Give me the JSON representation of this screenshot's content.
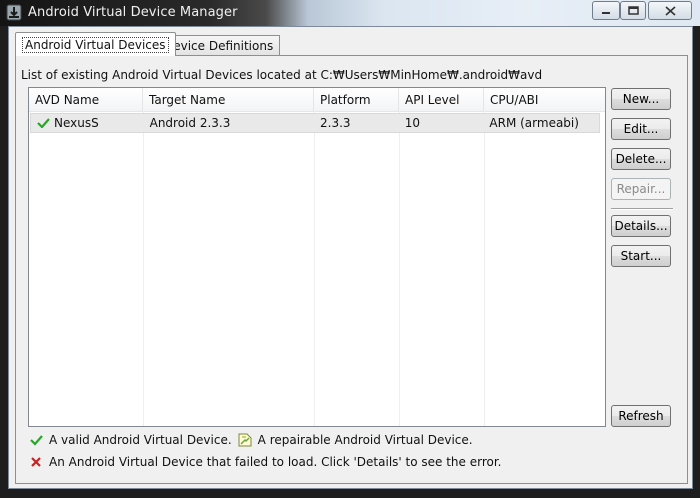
{
  "window": {
    "title": "Android Virtual Device Manager"
  },
  "tabs": [
    {
      "label": "Android Virtual Devices"
    },
    {
      "label": "Device Definitions"
    }
  ],
  "list_label": "List of existing Android Virtual Devices located at C:₩Users₩MinHome₩.android₩avd",
  "table": {
    "columns": [
      "AVD Name",
      "Target Name",
      "Platform",
      "API Level",
      "CPU/ABI"
    ],
    "rows": [
      {
        "status": "valid",
        "name": "NexusS",
        "target": "Android 2.3.3",
        "platform": "2.3.3",
        "api": "10",
        "cpu": "ARM (armeabi)"
      }
    ]
  },
  "buttons": {
    "new": "New...",
    "edit": "Edit...",
    "delete": "Delete...",
    "repair": "Repair...",
    "details": "Details...",
    "start": "Start...",
    "refresh": "Refresh"
  },
  "legend": {
    "valid": "A valid Android Virtual Device.",
    "repairable": "A repairable Android Virtual Device.",
    "failed": "An Android Virtual Device that failed to load. Click 'Details' to see the error."
  },
  "colors": {
    "valid": "#2aa52a",
    "failed": "#cc1f1f",
    "title_bar": "#dbe6f1"
  }
}
